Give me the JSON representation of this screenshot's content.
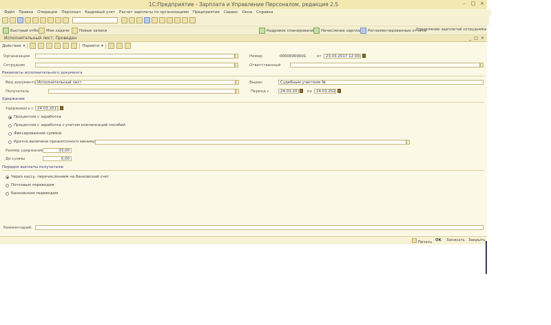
{
  "window": {
    "title": "1С:Предприятие - Зарплата и Управление Персоналом, редакция 2.5"
  },
  "menu": [
    "Файл",
    "Правка",
    "Операции",
    "Персонал",
    "Кадровый учет",
    "Расчет зарплаты по организациям",
    "Предприятие",
    "Сервис",
    "Окна",
    "Справка"
  ],
  "toolbar2": {
    "quick_menu": "Быстрый отбор",
    "my_tasks": "Мои задачи",
    "new_items": "Новые записи",
    "employee_acceptance": "Кадровое планирование",
    "payroll": "Начисление зарплаты",
    "reports": "Регламентированные отчеты",
    "payroll_list": "Управление зарплатой сотрудника"
  },
  "document": {
    "header_title": "Исполнительный лист: Проведен",
    "actions_label": "Действия",
    "goto_label": "Перейти"
  },
  "form": {
    "organization_label": "Организация",
    "organization_value": "",
    "employee_label": "Сотрудник",
    "employee_value": "",
    "number_label": "Номер:",
    "number_value": "00000000001",
    "date_from_label": "от",
    "date_value": "23.03.2017 12:00:00",
    "responsible_label": "Ответственный",
    "responsible_value": "",
    "section_details": "Реквизиты исполнительного документа",
    "doc_type_label": "Вид документа",
    "doc_type_value": "Исполнительный лист",
    "issued_by_label": "Выдан",
    "issued_by_value": "Судебным участком №",
    "recipient_label": "Получатель",
    "recipient_value": "",
    "period_label": "Период с",
    "period_from": "24.03.2017",
    "period_to_label": "по",
    "period_to": "24.03.2025",
    "section_deduction": "Удержание",
    "withhold_from_label": "Удерживать с",
    "withhold_from_value": "24.03.2017",
    "method_percent": "Процентом с заработка",
    "method_percent_compensation": "Процентом с заработка с учетом компенсаций пособий",
    "method_fixed": "Фиксированной суммой",
    "method_multiple_minimum": "Кратно величине прожиточного минимума",
    "deduction_size_label": "Размер удержания:",
    "deduction_size_value": "33,00",
    "debt_label": "До суммы",
    "debt_value": "0,00",
    "section_payment": "Порядок выплаты получателю",
    "pay_cash": "Через кассу, перечислением на банковский счет",
    "pay_postal": "Почтовым переводом",
    "pay_bank": "Банковским переводом",
    "comment_label": "Комментарий:",
    "comment_value": ""
  },
  "status": {
    "print_label": "Печать",
    "ok_label": "OK",
    "save_label": "Записать",
    "close_label": "Закрыть"
  }
}
